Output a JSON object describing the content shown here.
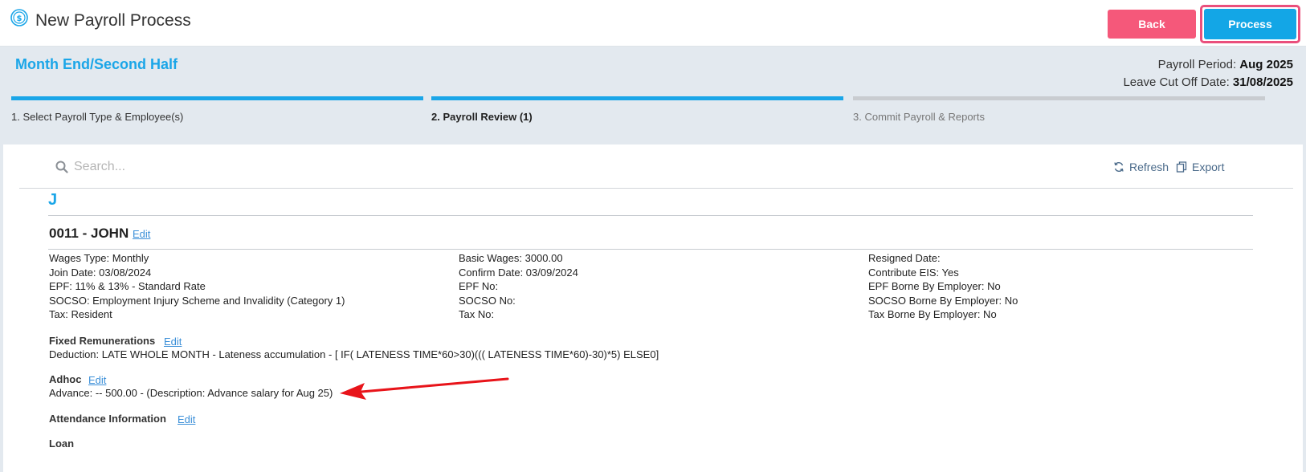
{
  "header": {
    "title": "New Payroll Process",
    "back_label": "Back",
    "process_label": "Process"
  },
  "subheader": {
    "payroll_type": "Month End/Second Half",
    "period_label": "Payroll Period:",
    "period_value": "Aug 2025",
    "cutoff_label": "Leave Cut Off Date:",
    "cutoff_value": "31/08/2025"
  },
  "steps": [
    {
      "label": "1. Select Payroll Type & Employee(s)",
      "state": "done"
    },
    {
      "label": "2. Payroll Review (1)",
      "state": "active"
    },
    {
      "label": "3. Commit Payroll & Reports",
      "state": "pending"
    }
  ],
  "toolbar": {
    "search_placeholder": "Search...",
    "refresh_label": "Refresh",
    "export_label": "Export"
  },
  "group_letter": "J",
  "employee": {
    "title": "0011 - JOHN",
    "edit_label": "Edit",
    "col1": [
      "Wages Type: Monthly",
      "Join Date: 03/08/2024",
      "EPF: 11% & 13% - Standard Rate",
      "SOCSO: Employment Injury Scheme and Invalidity (Category 1)",
      "Tax: Resident"
    ],
    "col2": [
      "Basic Wages: 3000.00",
      "Confirm Date: 03/09/2024",
      "EPF No:",
      "SOCSO No:",
      "Tax No:"
    ],
    "col3": [
      "Resigned Date:",
      "Contribute EIS: Yes",
      "EPF Borne By Employer: No",
      "SOCSO Borne By Employer: No",
      "Tax Borne By Employer: No"
    ]
  },
  "sections": {
    "fixed_title": "Fixed Remunerations",
    "fixed_edit": "Edit",
    "fixed_line": "Deduction: LATE WHOLE MONTH - Lateness accumulation - [ IF( LATENESS TIME*60>30)((( LATENESS TIME*60)-30)*5) ELSE0]",
    "adhoc_title": "Adhoc",
    "adhoc_edit": "Edit",
    "adhoc_line": "Advance: -- 500.00 - (Description: Advance salary for Aug 25)",
    "attendance_title": "Attendance Information",
    "attendance_edit": "Edit",
    "loan_title": "Loan"
  },
  "colors": {
    "accent": "#1ba6e8",
    "back_button": "#f5587a",
    "process_button": "#13a6e6",
    "highlight_border": "#ea4f7c",
    "annotation_arrow": "#e8141a"
  }
}
